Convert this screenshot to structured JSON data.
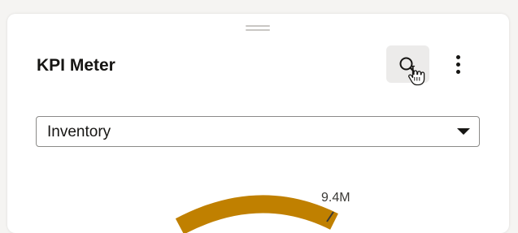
{
  "widget": {
    "title": "KPI Meter"
  },
  "toolbar": {
    "search_icon": "search-icon",
    "more_icon": "more-vertical-icon"
  },
  "measure_select": {
    "selected": "Inventory"
  },
  "gauge": {
    "label": "9.4M",
    "value": 9.4,
    "unit": "M",
    "color": "#c08000"
  },
  "colors": {
    "accent": "#c08000",
    "text": "#161513",
    "button_bg": "#ecebea"
  }
}
